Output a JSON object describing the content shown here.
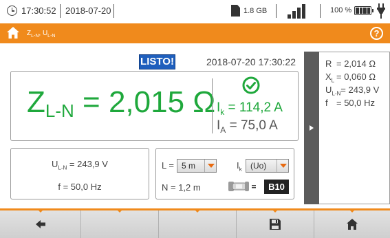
{
  "status": {
    "time": "17:30:52",
    "date": "2018-07-20",
    "storage": "1.8 GB",
    "battery_percent": "100 %",
    "icons": [
      "clock-icon",
      "sd-card-icon",
      "signal-icon",
      "battery-icon",
      "plug-icon"
    ]
  },
  "titlebar": {
    "title": "Zₗ-ₙ, Uₗ-ₙ",
    "title_main": "Z",
    "title_sub1": "L-N",
    "title_sep": ", U",
    "title_sub2": "L-N",
    "home_icon": "home-icon",
    "help_label": "?",
    "color": "#f08a1c"
  },
  "result": {
    "status_badge": "LISTO!",
    "timestamp": "2018-07-20 17:30:22",
    "z_symbol": "Z",
    "z_sub": "L-N",
    "z_value": " = 2,015 Ω",
    "ik_symbol": "I",
    "ik_sub": "k",
    "ik_value": " = 114,2 A",
    "ia_symbol": "I",
    "ia_sub": "A",
    "ia_value": " = 75,0 A",
    "ok_icon": "check-circle-icon",
    "value_color": "#1fa83c"
  },
  "measurements": {
    "uln_symbol": "U",
    "uln_sub": "L-N",
    "uln_value": " = 243,9 V",
    "freq": "f = 50,0 Hz"
  },
  "settings": {
    "l_label": "L =",
    "l_value": "5 m",
    "ik_label": "I",
    "ik_label_sub": "k",
    "ik_select_value": "(Uo)",
    "n_label": "N = 1,2 m",
    "fuse_icon": "fuse-icon",
    "fuse_type": "B10"
  },
  "side_panel": {
    "r_key": "R",
    "r_val": "= 2,014 Ω",
    "x_key": "X",
    "x_sub": "L",
    "x_val": "= 0,060 Ω",
    "u_key": "U",
    "u_sub": "L-N",
    "u_val": "= 243,9 V",
    "f_key": "f",
    "f_val": "= 50,0 Hz"
  },
  "toolbar": {
    "buttons": [
      "back-arrow-icon",
      "",
      "",
      "save-icon",
      "home-icon"
    ]
  }
}
